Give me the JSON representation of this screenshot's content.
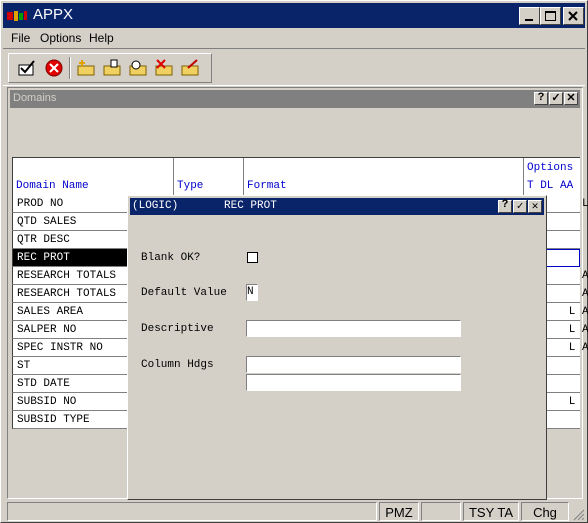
{
  "window": {
    "title": "APPX"
  },
  "menu": [
    {
      "label": "File"
    },
    {
      "label": "Options"
    },
    {
      "label": "Help"
    }
  ],
  "toolbar": {
    "buttons": [
      {
        "icon": "check-icon"
      },
      {
        "icon": "cancel-icon"
      },
      {
        "icon": "add-record-icon"
      },
      {
        "icon": "change-record-icon"
      },
      {
        "icon": "inquire-record-icon"
      },
      {
        "icon": "delete-record-icon"
      },
      {
        "icon": "edit-record-icon"
      }
    ]
  },
  "domains_window": {
    "title": "Domains",
    "columns": {
      "domain_name": "Domain Name",
      "type": "Type",
      "format": "Format",
      "options": "Options",
      "options_sub": "T DL AA"
    },
    "rows": [
      {
        "name": "PROD NO",
        "options": "     L",
        "selected": false
      },
      {
        "name": "QTD SALES",
        "options": "",
        "selected": false
      },
      {
        "name": "QTR DESC",
        "options": "",
        "selected": false
      },
      {
        "name": "REC PROT",
        "options": "",
        "selected": true
      },
      {
        "name": "RESEARCH TOTALS",
        "options": "     AA",
        "selected": false
      },
      {
        "name": "RESEARCH TOTALS",
        "options": "     AA",
        "selected": false
      },
      {
        "name": "SALES AREA",
        "options": "   L AA",
        "selected": false
      },
      {
        "name": "SALPER NO",
        "options": "   L AA",
        "selected": false
      },
      {
        "name": "SPEC INSTR NO",
        "options": "   L AA",
        "selected": false
      },
      {
        "name": "ST",
        "options": "",
        "selected": false
      },
      {
        "name": "STD DATE",
        "options": "",
        "selected": false
      },
      {
        "name": "SUBSID NO",
        "options": "   L",
        "selected": false
      },
      {
        "name": "SUBSID TYPE",
        "options": "",
        "selected": false
      }
    ]
  },
  "dialog": {
    "title_left": "(LOGIC)",
    "title_center": "REC PROT",
    "fields": {
      "blank_ok": {
        "label": "Blank OK?",
        "checked": false
      },
      "default_value": {
        "label": "Default Value",
        "value": "N"
      },
      "descriptive": {
        "label": "Descriptive",
        "value": ""
      },
      "column_hdgs": {
        "label": "Column Hdgs",
        "line1": "",
        "line2": ""
      }
    }
  },
  "statusbar": {
    "panes": [
      "",
      "PMZ",
      "",
      "TSY TA",
      "Chg"
    ]
  },
  "colors": {
    "title_active": "#0a246a",
    "title_inactive": "#808080",
    "header_text": "#0000cc",
    "face": "#d4d0c8"
  }
}
